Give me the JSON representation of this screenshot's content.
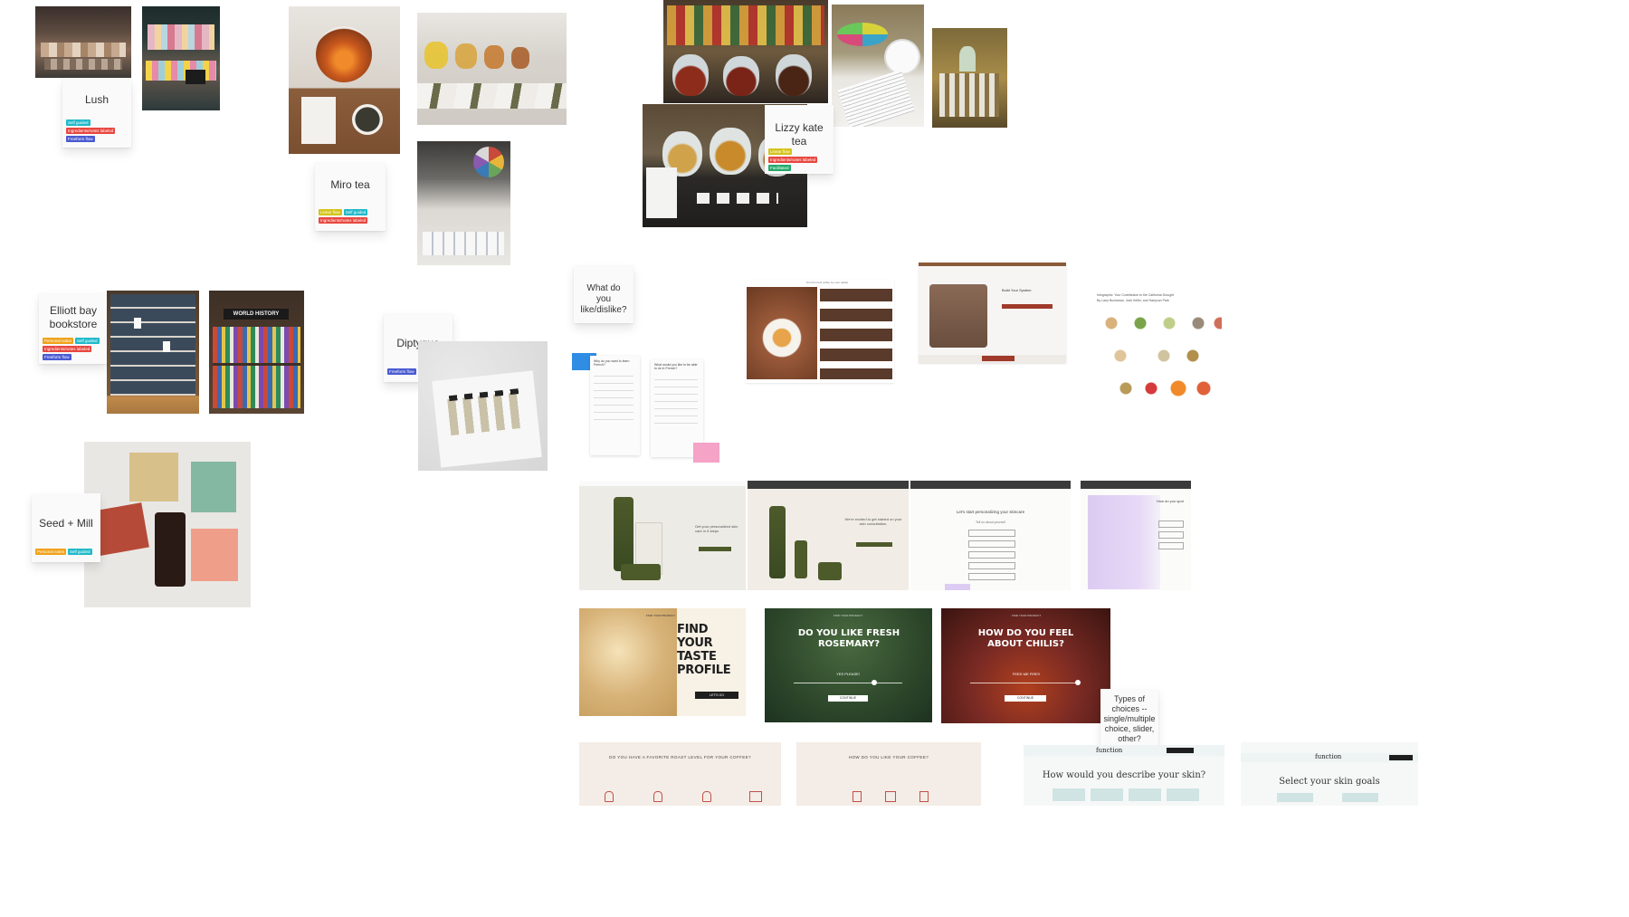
{
  "notes": {
    "lush": {
      "title": "Lush",
      "tags": [
        {
          "label": "Self guided",
          "color": "#1fb9c9"
        },
        {
          "label": "Ingredients/notes labeled",
          "color": "#e8473f"
        },
        {
          "label": "Freeform flow",
          "color": "#4a5ad1"
        }
      ]
    },
    "miro": {
      "title": "Miro tea",
      "tags": [
        {
          "label": "Linear flow",
          "color": "#d4c31b"
        },
        {
          "label": "Self guided",
          "color": "#1fb9c9"
        },
        {
          "label": "Ingredients/notes labeled",
          "color": "#e8473f"
        }
      ]
    },
    "lizzy": {
      "title": "Lizzy kate tea",
      "tags": [
        {
          "label": "Linear flow",
          "color": "#d4c31b"
        },
        {
          "label": "Ingredients/notes labeled",
          "color": "#e8473f"
        },
        {
          "label": "Facilitated",
          "color": "#22a86a"
        }
      ]
    },
    "elliott": {
      "title": "Elliott bay bookstore",
      "tags": [
        {
          "label": "Personal notes",
          "color": "#f0a21a"
        },
        {
          "label": "Self guided",
          "color": "#1fb9c9"
        },
        {
          "label": "Ingredients/notes labeled",
          "color": "#e8473f"
        },
        {
          "label": "Freeform flow",
          "color": "#4a5ad1"
        }
      ]
    },
    "diptyque": {
      "title": "Diptyque",
      "tags": [
        {
          "label": "Freeform flow",
          "color": "#4a5ad1"
        },
        {
          "label": "Self guided",
          "color": "#1fb9c9"
        }
      ]
    },
    "seed": {
      "title": "Seed + Mill",
      "tags": [
        {
          "label": "Personal notes",
          "color": "#f0a21a"
        },
        {
          "label": "Self guided",
          "color": "#1fb9c9"
        }
      ]
    },
    "likes": {
      "title": "What do you like/dislike?"
    },
    "choices": {
      "title": "Types of choices -- single/multiple choice, slider, other?"
    }
  },
  "screens": {
    "quiz_q1": "Why do you want to learn French?",
    "quiz_q2": "What would you like to be able to do in French?",
    "coffee_heading": "Find the best coffee for your palate",
    "build_heading": "Build Your System",
    "infographic_title": "Infographic: Your Contribution to the California Drought",
    "infographic_byline": "By Larry Buchanan, Josh Keller, and Haeyoun Park",
    "skin_cta": "Get your personalized skin care in 5 steps",
    "skin_started": "We're excited to get started on your skin consultation.",
    "skin_personalize": "Let's start personalizing your skincare",
    "skin_about": "Tell us about yourself",
    "skin_spot": "How do you spot",
    "taste_profile": "FIND YOUR TASTE PROFILE",
    "rosemary": "DO YOU LIKE FRESH ROSEMARY?",
    "chilis": "HOW DO YOU FEEL ABOUT CHILIS?",
    "yes_please": "YES PLEASE!",
    "feed_me_fire": "FEED ME FIRE!!",
    "continue": "CONTINUE",
    "lets_go": "LET'S GO",
    "find_product": "FIND YOUR PRODUCT",
    "roast": "DO YOU HAVE A FAVORITE ROAST LEVEL FOR YOUR COFFEE?",
    "like_coffee": "HOW DO YOU LIKE YOUR COFFEE?",
    "describe_skin": "How would you describe your skin?",
    "skin_goals": "Select your skin goals",
    "function_logo": "function",
    "book_sign": "WORLD HISTORY"
  },
  "colors": {
    "canvas": "#ffffff",
    "sticky": "#fafafa",
    "accent_blue": "#2f8de4",
    "accent_pink": "#f5a3c7",
    "lavender": "#dccbf2",
    "rosemary_green": "#2f4a2c",
    "chili_red": "#7a2a24",
    "taste_gold": "#d9b98a"
  }
}
